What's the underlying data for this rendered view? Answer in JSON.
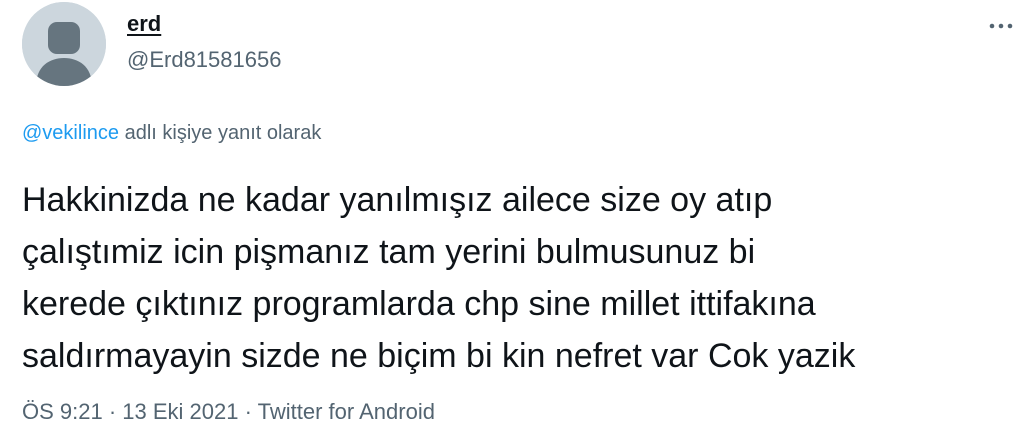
{
  "author": {
    "display_name": "erd",
    "handle": "@Erd81581656",
    "avatar_icon": "default-avatar-icon"
  },
  "reply_context": {
    "mention": "@vekilince",
    "suffix": " adlı kişiye yanıt olarak"
  },
  "tweet": {
    "lines": [
      "Hakkinizda ne kadar yanılmışız ailece size oy atıp",
      "çalıştımiz icin pişmanız tam yerini bulmusunuz bi",
      "kerede çıktınız programlarda chp sine millet ittifakına",
      "saldırmayayin sizde ne biçim bi kin nefret var Cok yazik"
    ]
  },
  "meta": {
    "time": "ÖS 9:21",
    "separator": " · ",
    "date": "13 Eki 2021",
    "source": "Twitter for Android"
  },
  "colors": {
    "text": "#0f1419",
    "secondary": "#536471",
    "link": "#1d9bf0",
    "avatar_bg": "#ccd6dd"
  },
  "icons": {
    "more": "more-horizontal-icon"
  }
}
